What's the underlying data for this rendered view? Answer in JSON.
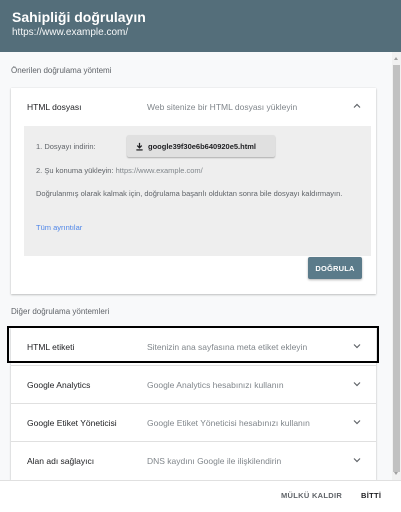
{
  "header": {
    "title": "Sahipliği doğrulayın",
    "subtitle": "https://www.example.com/"
  },
  "recommended": {
    "label": "Önerilen doğrulama yöntemi",
    "method": {
      "name": "HTML dosyası",
      "description": "Web sitenize bir HTML dosyası yükleyin",
      "step1_label": "1. Dosyayı indirin:",
      "file_name": "google39f30e6b640920e5.html",
      "step2_label": "2. Şu konuma yükleyin:",
      "step2_url": "https://www.example.com/",
      "note": "Doğrulanmış olarak kalmak için, doğrulama başarılı olduktan sonra bile dosyayı kaldırmayın.",
      "details_link": "Tüm ayrıntılar",
      "verify_button": "DOĞRULA"
    }
  },
  "other": {
    "label": "Diğer doğrulama yöntemleri",
    "methods": [
      {
        "name": "HTML etiketi",
        "description": "Sitenizin ana sayfasına meta etiket ekleyin"
      },
      {
        "name": "Google Analytics",
        "description": "Google Analytics hesabınızı kullanın"
      },
      {
        "name": "Google Etiket Yöneticisi",
        "description": "Google Etiket Yöneticisi hesabınızı kullanın"
      },
      {
        "name": "Alan adı sağlayıcı",
        "description": "DNS kaydını Google ile ilişkilendirin"
      }
    ]
  },
  "footer": {
    "remove_label": "MÜLKÜ KALDIR",
    "done_label": "BİTTİ"
  },
  "colors": {
    "header_bg": "#546e7a",
    "verify_button_bg": "#5b7b8a",
    "link": "#4f86e8"
  }
}
